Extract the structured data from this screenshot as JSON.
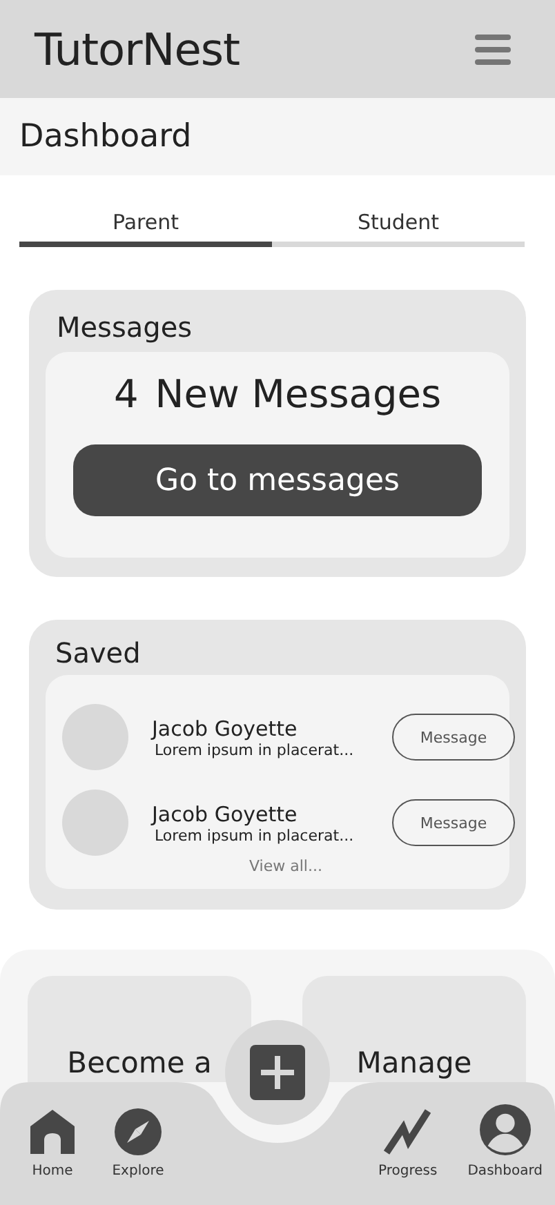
{
  "app_bar": {
    "title": "TutorNest"
  },
  "page_title": "Dashboard",
  "tabs": [
    {
      "label": "Parent",
      "selected": true
    },
    {
      "label": "Student",
      "selected": false
    }
  ],
  "messages_card": {
    "title": "Messages",
    "count": "4",
    "summary": "New Messages",
    "button": "Go to messages"
  },
  "saved_card": {
    "title": "Saved",
    "items": [
      {
        "name": "Jacob Goyette",
        "snippet": "Lorem ipsum in placerat...",
        "button": "Message"
      },
      {
        "name": "Jacob Goyette",
        "snippet": "Lorem ipsum in placerat...",
        "button": "Message"
      }
    ],
    "view_all": "View all..."
  },
  "tiles": [
    {
      "label": "Become a"
    },
    {
      "label": "Manage"
    }
  ],
  "bottom_nav": [
    {
      "kind": "home",
      "label": "Home"
    },
    {
      "kind": "explore",
      "label": "Explore"
    },
    {
      "kind": "add"
    },
    {
      "kind": "progress",
      "label": "Progress"
    },
    {
      "kind": "profile",
      "label": "Dashboard"
    }
  ]
}
